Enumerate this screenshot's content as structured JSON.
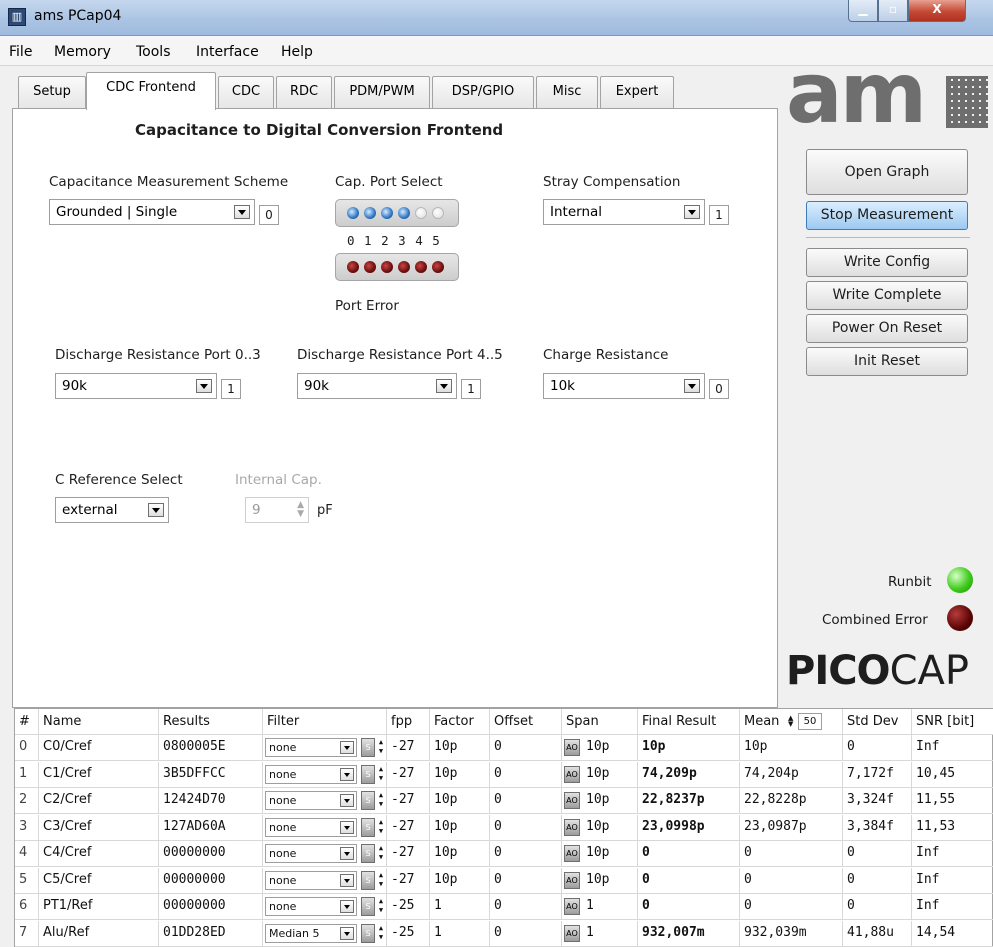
{
  "window": {
    "title": "ams PCap04",
    "close_label": "X"
  },
  "menu": [
    "File",
    "Memory",
    "Tools",
    "Interface",
    "Help"
  ],
  "tabs": [
    "Setup",
    "CDC Frontend",
    "CDC",
    "RDC",
    "PDM/PWM",
    "DSP/GPIO",
    "Misc",
    "Expert"
  ],
  "active_tab": "CDC Frontend",
  "panel": {
    "title": "Capacitance to Digital Conversion Frontend",
    "cap_scheme": {
      "label": "Capacitance Measurement Scheme",
      "value": "Grounded | Single",
      "index": "0"
    },
    "cap_port": {
      "label": "Cap. Port Select",
      "port_labels": "0 1 2 3 4 5",
      "error_label": "Port Error"
    },
    "stray": {
      "label": "Stray Compensation",
      "value": "Internal",
      "index": "1"
    },
    "discharge_03": {
      "label": "Discharge Resistance Port 0..3",
      "value": "90k",
      "index": "1"
    },
    "discharge_45": {
      "label": "Discharge Resistance Port 4..5",
      "value": "90k",
      "index": "1"
    },
    "charge": {
      "label": "Charge Resistance",
      "value": "10k",
      "index": "0"
    },
    "cref": {
      "label": "C Reference Select",
      "value": "external"
    },
    "internal_cap": {
      "label": "Internal Cap.",
      "value": "9",
      "unit": "pF"
    }
  },
  "buttons": {
    "open_graph": "Open Graph",
    "stop_measurement": "Stop Measurement",
    "write_config": "Write Config",
    "write_complete": "Write Complete",
    "power_on_reset": "Power On Reset",
    "init_reset": "Init Reset"
  },
  "status": {
    "runbit": "Runbit",
    "combined_error": "Combined Error"
  },
  "logos": {
    "ams": "am",
    "picocap_bold": "PICO",
    "picocap_light": "CAP"
  },
  "table": {
    "headers": [
      "#",
      "Name",
      "Results",
      "Filter",
      "fpp",
      "Factor",
      "Offset",
      "Span",
      "Final Result",
      "Mean",
      "Std Dev",
      "SNR [bit]"
    ],
    "mean_count": "50",
    "s_label": "S",
    "ao_label": "AO",
    "rows": [
      {
        "idx": "0",
        "name": "C0/Cref",
        "result": "0800005E",
        "filter": "none",
        "fpp": "-27",
        "factor": "10p",
        "offset": "0",
        "span": "10p",
        "final": "10p",
        "mean": "10p",
        "std": "0",
        "snr": "Inf"
      },
      {
        "idx": "1",
        "name": "C1/Cref",
        "result": "3B5DFFCC",
        "filter": "none",
        "fpp": "-27",
        "factor": "10p",
        "offset": "0",
        "span": "10p",
        "final": "74,209p",
        "mean": "74,204p",
        "std": "7,172f",
        "snr": "10,45"
      },
      {
        "idx": "2",
        "name": "C2/Cref",
        "result": "12424D70",
        "filter": "none",
        "fpp": "-27",
        "factor": "10p",
        "offset": "0",
        "span": "10p",
        "final": "22,8237p",
        "mean": "22,8228p",
        "std": "3,324f",
        "snr": "11,55"
      },
      {
        "idx": "3",
        "name": "C3/Cref",
        "result": "127AD60A",
        "filter": "none",
        "fpp": "-27",
        "factor": "10p",
        "offset": "0",
        "span": "10p",
        "final": "23,0998p",
        "mean": "23,0987p",
        "std": "3,384f",
        "snr": "11,53"
      },
      {
        "idx": "4",
        "name": "C4/Cref",
        "result": "00000000",
        "filter": "none",
        "fpp": "-27",
        "factor": "10p",
        "offset": "0",
        "span": "10p",
        "final": "0",
        "mean": "0",
        "std": "0",
        "snr": "Inf"
      },
      {
        "idx": "5",
        "name": "C5/Cref",
        "result": "00000000",
        "filter": "none",
        "fpp": "-27",
        "factor": "10p",
        "offset": "0",
        "span": "10p",
        "final": "0",
        "mean": "0",
        "std": "0",
        "snr": "Inf"
      },
      {
        "idx": "6",
        "name": "PT1/Ref",
        "result": "00000000",
        "filter": "none",
        "fpp": "-25",
        "factor": "1",
        "offset": "0",
        "span": "1",
        "final": "0",
        "mean": "0",
        "std": "0",
        "snr": "Inf"
      },
      {
        "idx": "7",
        "name": "Alu/Ref",
        "result": "01DD28ED",
        "filter": "Median 5",
        "fpp": "-25",
        "factor": "1",
        "offset": "0",
        "span": "1",
        "final": "932,007m",
        "mean": "932,039m",
        "std": "41,88u",
        "snr": "14,54"
      }
    ]
  },
  "colors": {
    "active_button": "#9cc9f0",
    "runbit_led": "#3fcb1c",
    "error_led": "#5c0505",
    "port_led_on": "#2d74c2"
  }
}
